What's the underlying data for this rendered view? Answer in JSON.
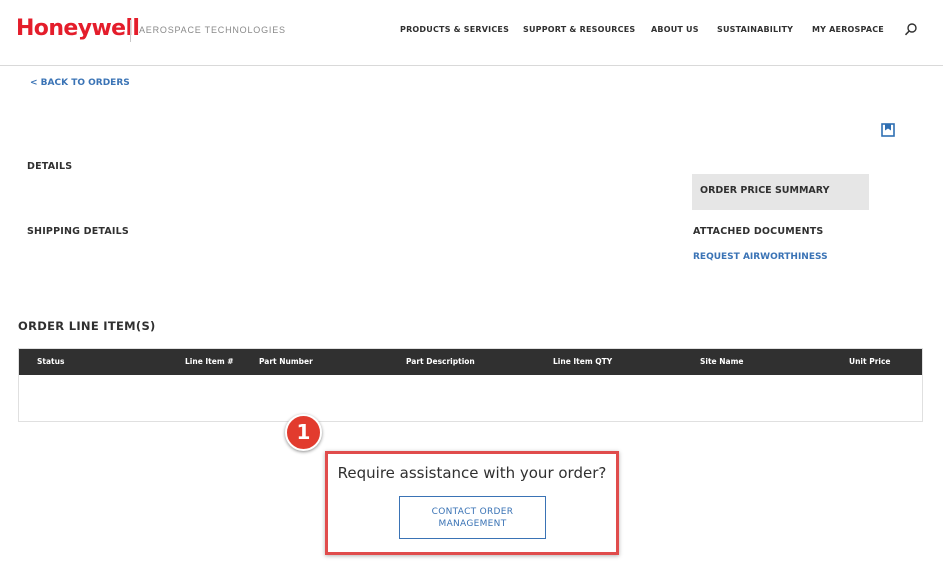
{
  "header": {
    "logo": "Honeywell",
    "brand_subtitle": "AEROSPACE TECHNOLOGIES",
    "nav": {
      "products": "PRODUCTS & SERVICES",
      "support": "SUPPORT & RESOURCES",
      "about": "ABOUT US",
      "sustainability": "SUSTAINABILITY",
      "my_aerospace": "MY AEROSPACE"
    },
    "search_icon": "search-icon"
  },
  "page": {
    "back_link": "< BACK TO ORDERS",
    "bookmark_icon": "bookmark-icon"
  },
  "details": {
    "details_label": "DETAILS",
    "shipping_label": "SHIPPING DETAILS"
  },
  "side_panel": {
    "order_price_summary": "ORDER PRICE SUMMARY",
    "attached_documents": "ATTACHED DOCUMENTS",
    "request_airworthiness": "REQUEST AIRWORTHINESS"
  },
  "line_items": {
    "title": "ORDER LINE ITEM(S)",
    "columns": {
      "status": "Status",
      "line_item_no": "Line Item #",
      "part_number": "Part Number",
      "part_description": "Part Description",
      "line_item_qty": "Line Item QTY",
      "site_name": "Site Name",
      "unit_price": "Unit Price"
    },
    "rows": []
  },
  "assistance": {
    "step_number": "1",
    "question": "Require assistance with your order?",
    "contact_button": "CONTACT ORDER MANAGEMENT"
  },
  "colors": {
    "brand_red": "#e41d2b",
    "link_blue": "#3a73b5",
    "table_header": "#303030",
    "highlight_red": "#e04c4c",
    "summary_bg": "#e6e6e6"
  }
}
